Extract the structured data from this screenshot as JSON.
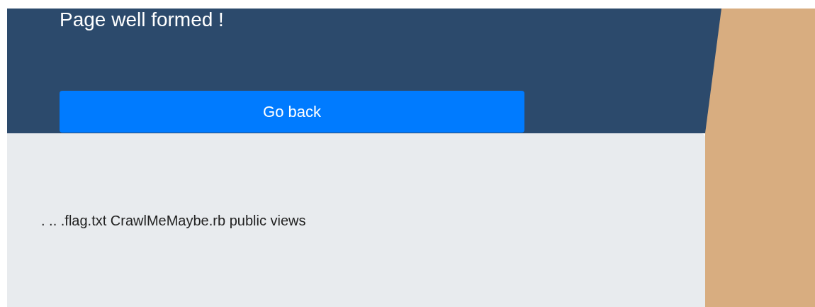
{
  "header": {
    "message": "Page well formed !"
  },
  "button": {
    "label": "Go back"
  },
  "output": {
    "text": ". .. .flag.txt CrawlMeMaybe.rb public views"
  }
}
